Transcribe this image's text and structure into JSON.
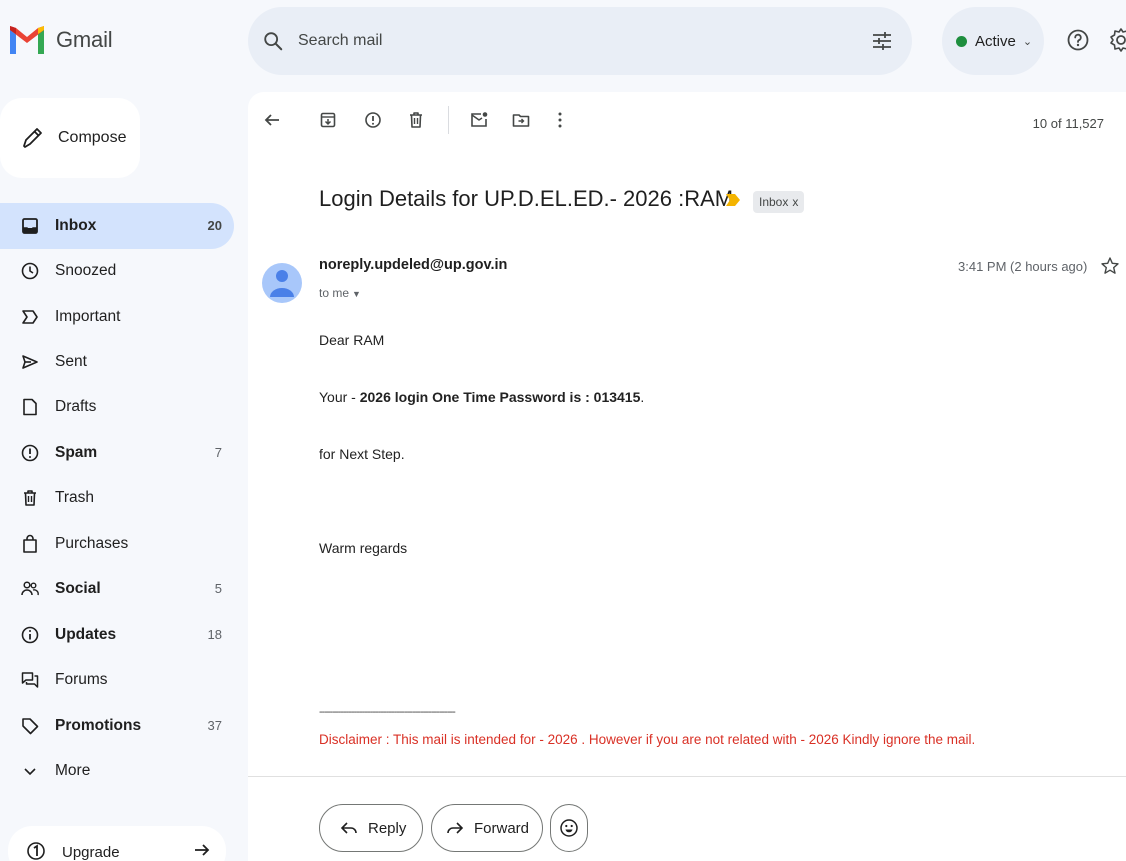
{
  "app": {
    "name": "Gmail"
  },
  "search": {
    "placeholder": "Search mail"
  },
  "status": {
    "label": "Active"
  },
  "sidebar": {
    "compose": "Compose",
    "items": [
      {
        "label": "Inbox",
        "count": "20",
        "icon": "inbox-icon"
      },
      {
        "label": "Snoozed",
        "count": "",
        "icon": "clock-icon"
      },
      {
        "label": "Important",
        "count": "",
        "icon": "important-icon"
      },
      {
        "label": "Sent",
        "count": "",
        "icon": "send-icon"
      },
      {
        "label": "Drafts",
        "count": "",
        "icon": "draft-icon"
      },
      {
        "label": "Spam",
        "count": "7",
        "icon": "spam-icon"
      },
      {
        "label": "Trash",
        "count": "",
        "icon": "trash-icon"
      },
      {
        "label": "Purchases",
        "count": "",
        "icon": "shopping-bag-icon"
      },
      {
        "label": "Social",
        "count": "5",
        "icon": "people-icon"
      },
      {
        "label": "Updates",
        "count": "18",
        "icon": "info-icon"
      },
      {
        "label": "Forums",
        "count": "",
        "icon": "forum-icon"
      },
      {
        "label": "Promotions",
        "count": "37",
        "icon": "tag-icon"
      },
      {
        "label": "More",
        "count": "",
        "icon": "chevron-down-icon"
      }
    ],
    "upgrade": "Upgrade"
  },
  "toolbar": {
    "counter": "10 of 11,527"
  },
  "email": {
    "subject": "Login Details for UP.D.EL.ED.- 2026 :RAM",
    "label_chip": "Inbox",
    "label_chip_close": "x",
    "sender": "noreply.updeled@up.gov.in",
    "recipient": "to me",
    "time": "3:41 PM (2 hours ago)",
    "greeting": "Dear RAM",
    "otp_prefix": "Your - ",
    "otp_bold": "2026 login One Time Password is : 013415",
    "otp_suffix": ".",
    "next_step": "for Next Step.",
    "signoff": "Warm regards",
    "rule": "---------------------------------------------------",
    "disclaimer": "Disclaimer : This mail is intended for - 2026 . However if you are not related with - 2026 Kindly ignore the mail."
  },
  "actions": {
    "reply": "Reply",
    "forward": "Forward"
  },
  "colors": {
    "accent": "#d3e3fd",
    "active_dot": "#1e8e3e",
    "disclaimer": "#d93025",
    "importance": "#f4b400"
  }
}
